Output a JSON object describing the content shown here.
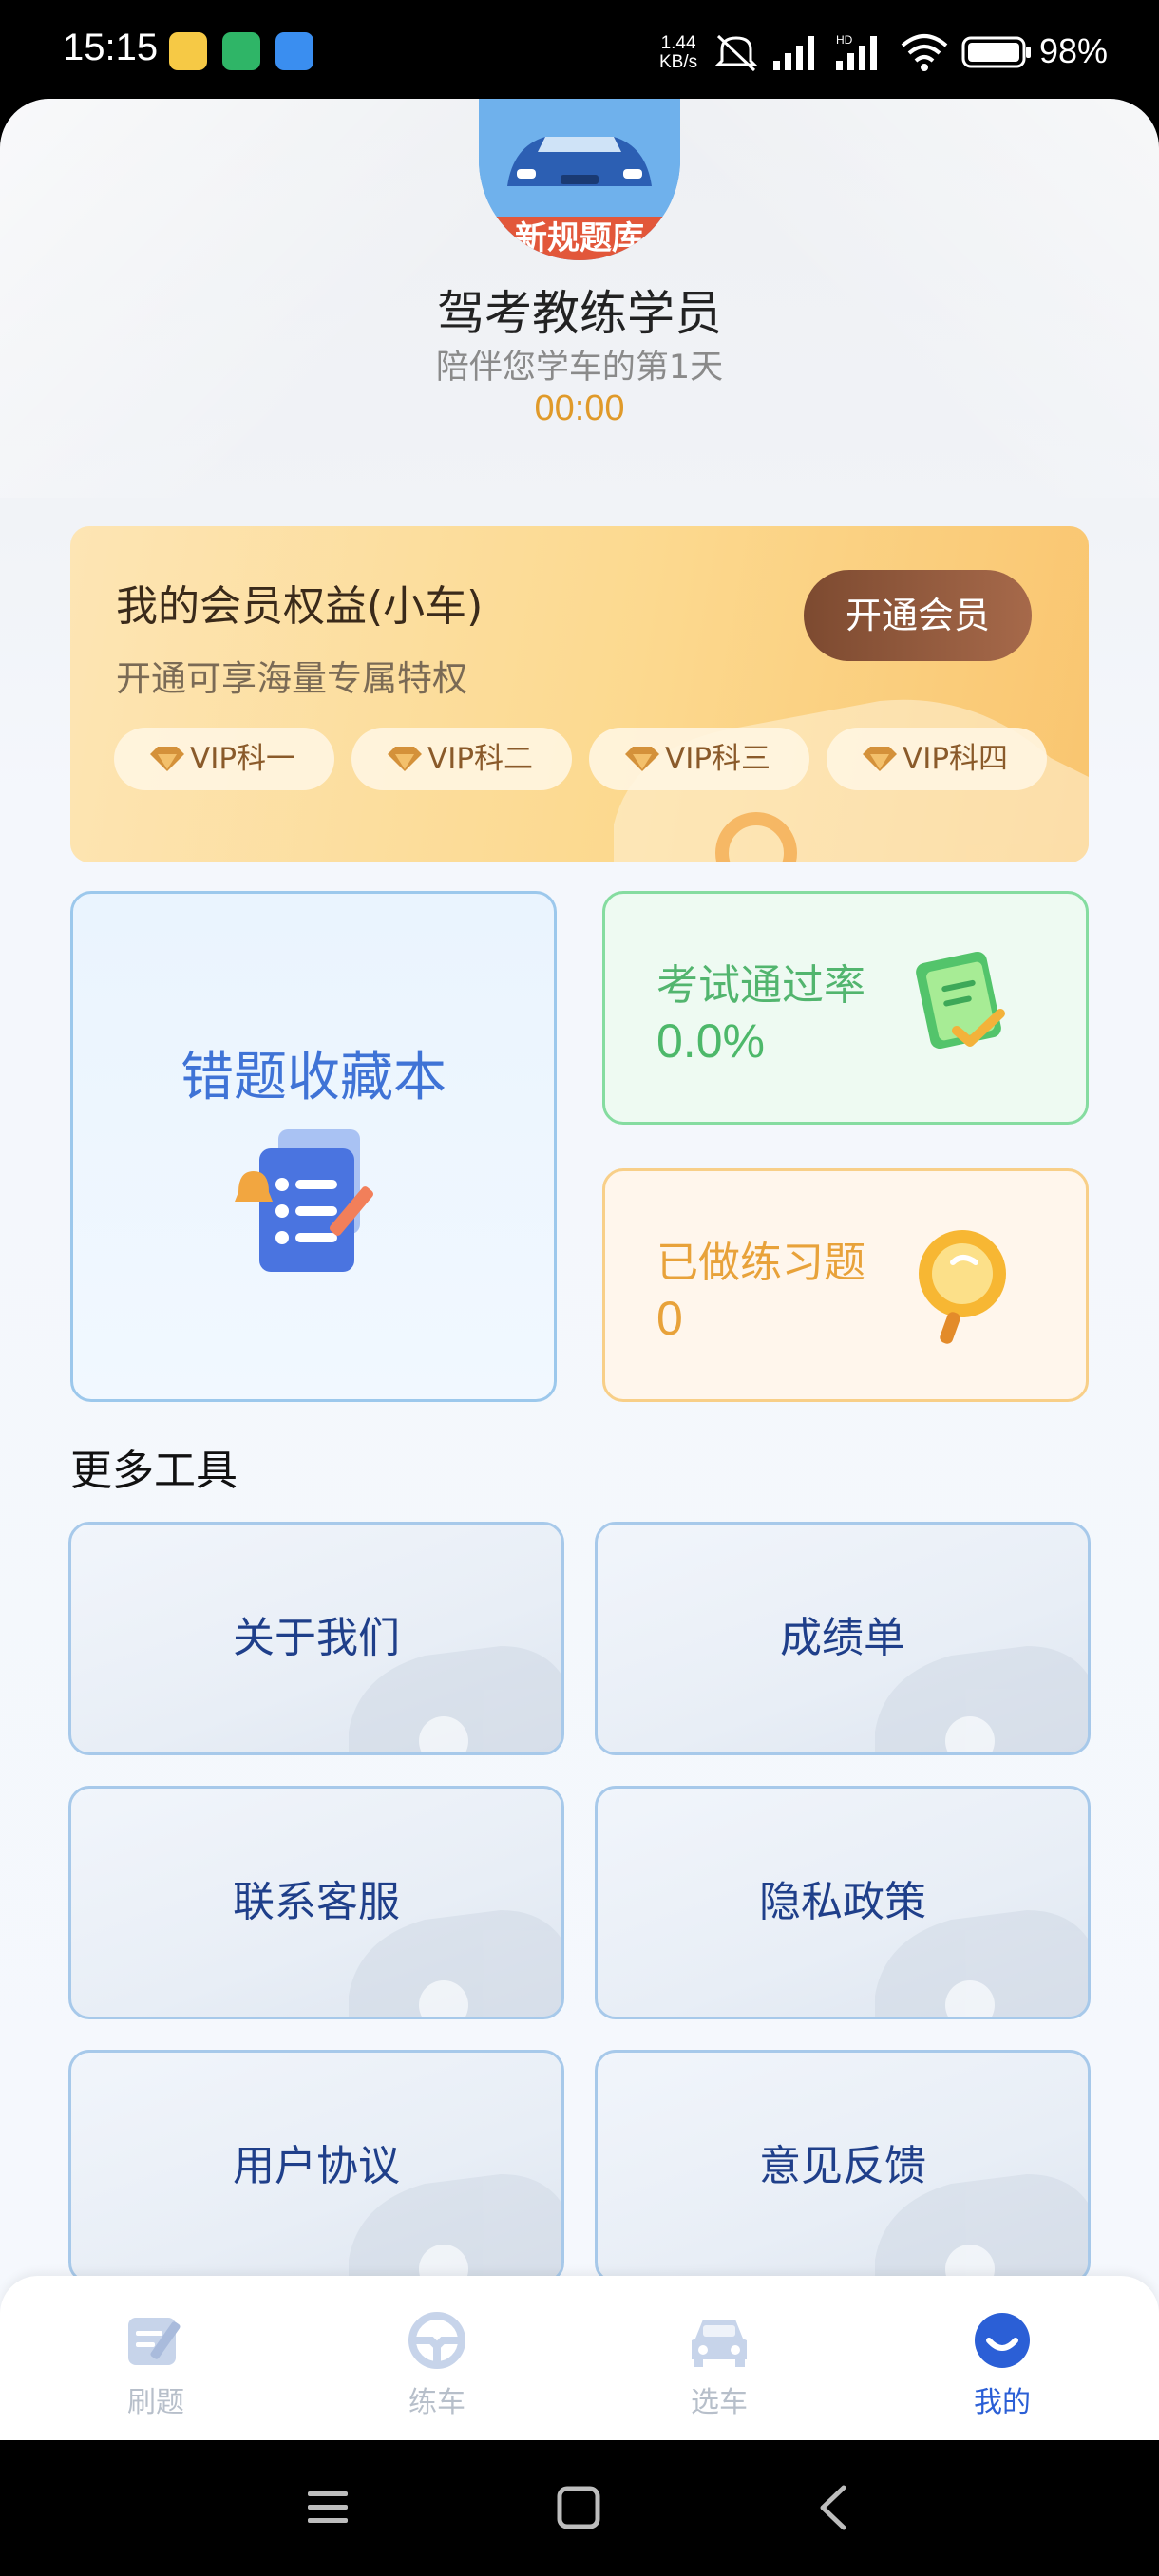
{
  "status_bar": {
    "time": "15:15",
    "net_speed_value": "1.44",
    "net_speed_unit": "KB/s",
    "battery": "98%",
    "icons": [
      "app-notification-icon",
      "app-notification-icon",
      "app-notification-icon",
      "net-speed",
      "mute-icon",
      "signal-icon",
      "hd-signal-icon",
      "wifi-icon",
      "battery-icon"
    ]
  },
  "profile": {
    "avatar_label": "新规题库",
    "username": "驾考教练学员",
    "subtitle": "陪伴您学车的第1天",
    "timer": "00:00"
  },
  "vip": {
    "title": "我的会员权益(小车)",
    "subtitle": "开通可享海量专属特权",
    "button": "开通会员",
    "tags": [
      "VIP科一",
      "VIP科二",
      "VIP科三",
      "VIP科四"
    ]
  },
  "cards": {
    "wrong_book": "错题收藏本",
    "pass_rate_label": "考试通过率",
    "pass_rate_value": "0.0%",
    "done_label": "已做练习题",
    "done_value": "0"
  },
  "tools": {
    "title": "更多工具",
    "items": [
      "关于我们",
      "成绩单",
      "联系客服",
      "隐私政策",
      "用户协议",
      "意见反馈"
    ]
  },
  "nav": {
    "items": [
      "刷题",
      "练车",
      "选车",
      "我的"
    ],
    "active": "我的"
  },
  "colors": {
    "accent": "#2b5fd6",
    "timer": "#e09a2a",
    "vip_button": "#8a553a",
    "pass_green": "#4db86a",
    "done_orange": "#e8a23a"
  }
}
